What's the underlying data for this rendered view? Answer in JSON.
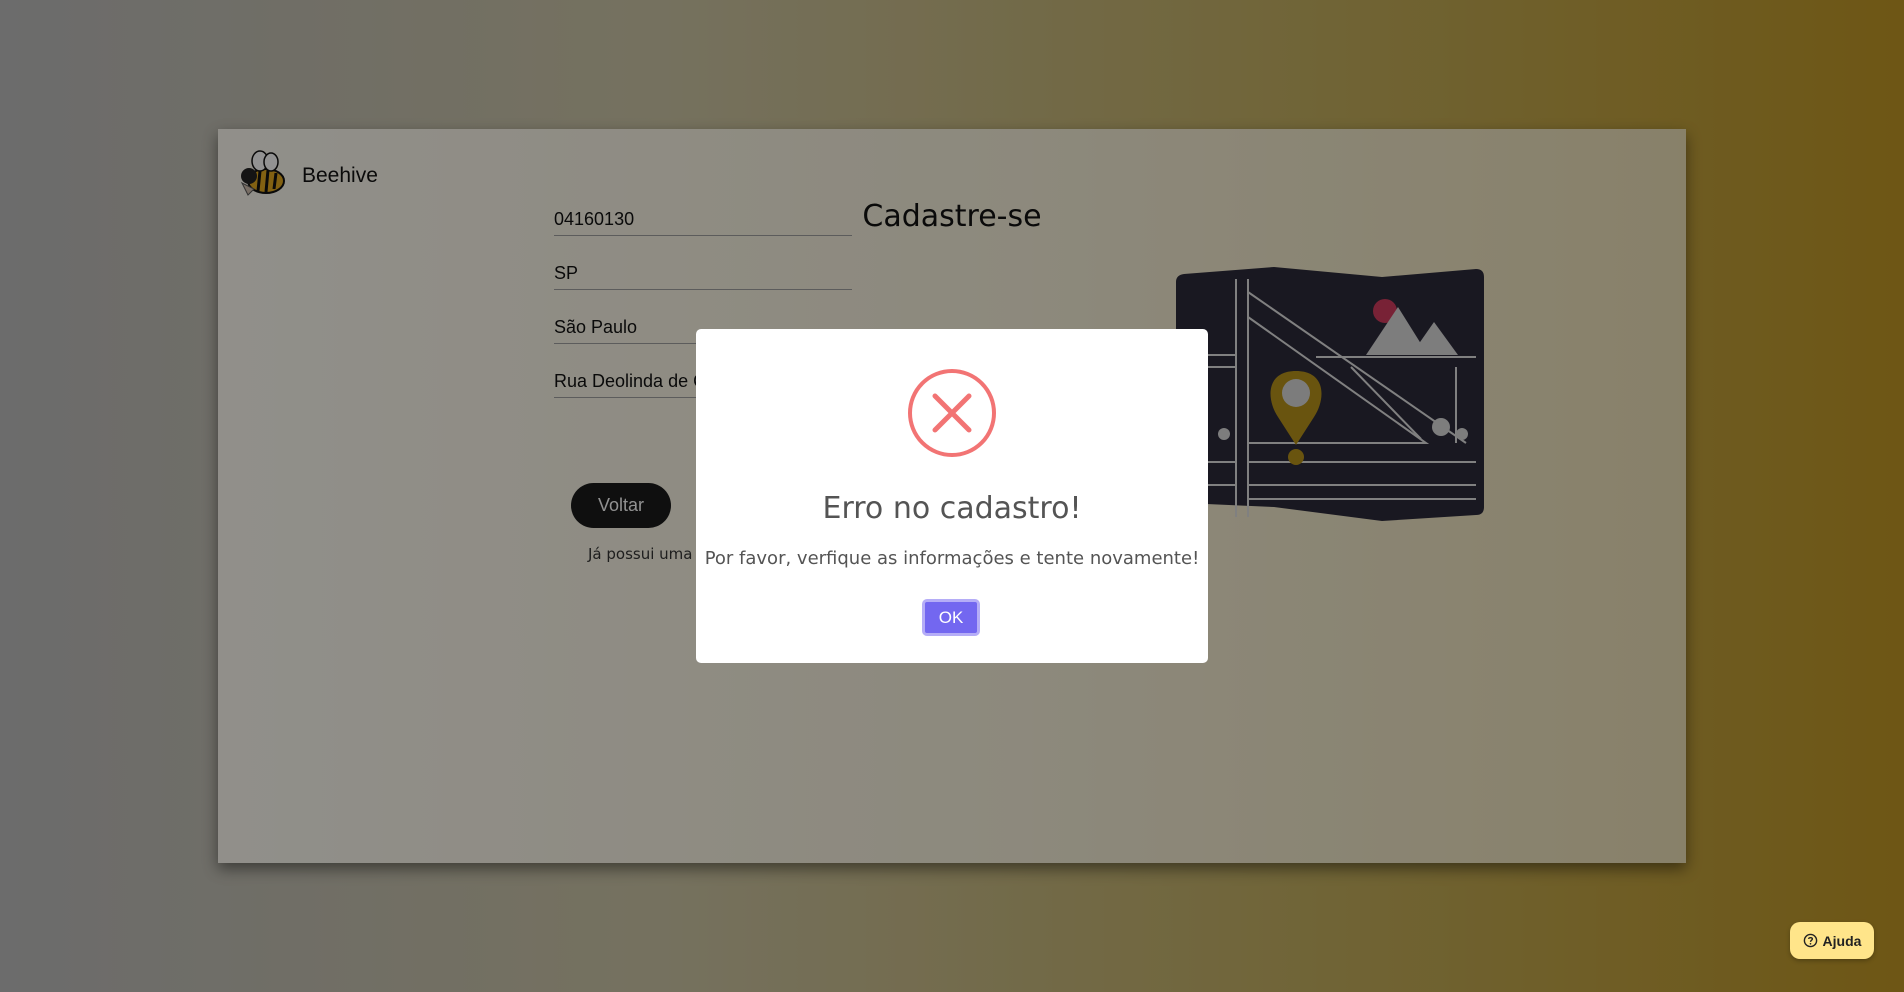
{
  "app": {
    "name": "Beehive"
  },
  "form": {
    "title": "Cadastre-se",
    "fields": [
      {
        "value": "04160130"
      },
      {
        "value": "SP"
      },
      {
        "value": "São Paulo"
      },
      {
        "value": "Rua Deolinda de Castro"
      }
    ],
    "back_label": "Voltar",
    "login_hint": "Já possui uma conta?"
  },
  "modal": {
    "icon": "error-x-icon",
    "title": "Erro no cadastro!",
    "message": "Por favor, verfique as informações e tente novamente!",
    "ok_label": "OK"
  },
  "help": {
    "label": "Ajuda"
  },
  "colors": {
    "accent": "#7367f0",
    "error": "#f27474",
    "map_pin": "#b08d1a",
    "map_bg": "#2a2838"
  }
}
